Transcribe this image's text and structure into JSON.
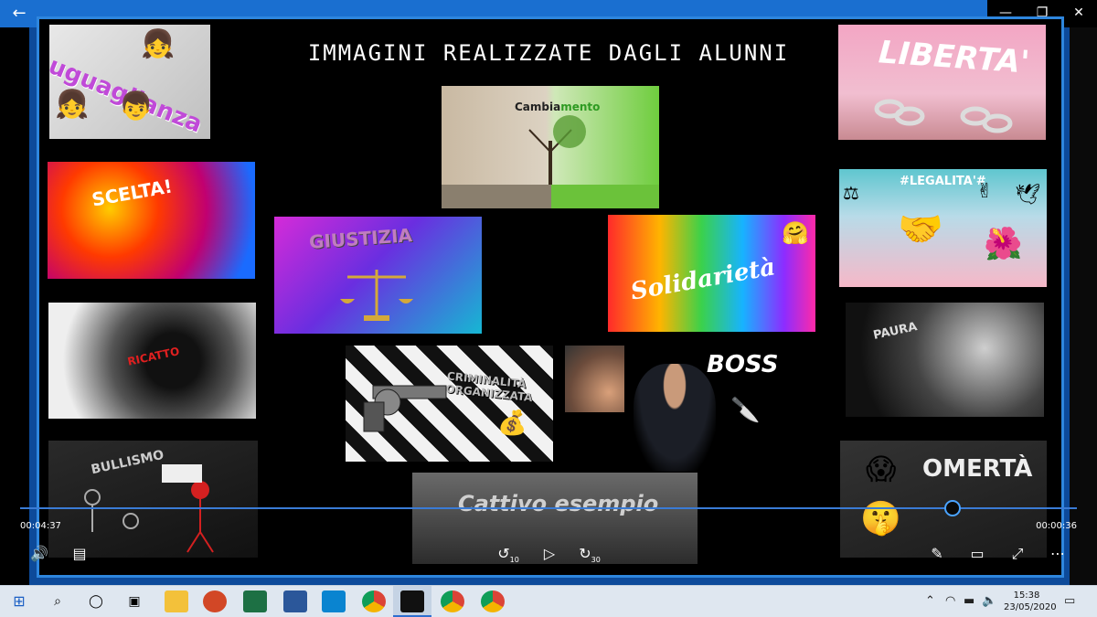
{
  "window": {
    "back_icon": "back-arrow-icon",
    "minimize": "—",
    "restore": "❐",
    "close": "✕"
  },
  "slide": {
    "title": "IMMAGINI REALIZZATE DAGLI ALUNNI",
    "tiles": {
      "uguaglianza": "uguaglianza",
      "scelta": "SCELTA!",
      "ricatto": "RICATTO",
      "bullismo": "BULLISMO",
      "cambiamento_a": "Cambia",
      "cambiamento_b": "mento",
      "giustizia": "GIUSTIZIA",
      "solidarieta": "Solidarietà",
      "criminalita": "CRIMINALITÀ ORGANIZZATA",
      "boss": "BOSS",
      "cattivo_esempio": "Cattivo esempio",
      "liberta": "LIBERTA'",
      "legalita": "#LEGALITA'#",
      "paura": "PAURA",
      "omerta": "OMERTÀ"
    }
  },
  "player": {
    "progress": 0.88,
    "elapsed": "00:04:37",
    "remaining": "00:00:36",
    "skip_back": "10",
    "skip_forward": "30"
  },
  "taskbar": {
    "time": "15:38",
    "date": "23/05/2020"
  }
}
